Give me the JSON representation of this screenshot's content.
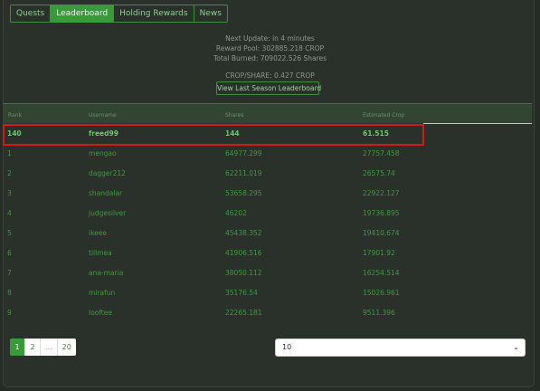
{
  "tabs": [
    {
      "label": "Quests",
      "active": false
    },
    {
      "label": "Leaderboard",
      "active": true
    },
    {
      "label": "Holding Rewards",
      "active": false
    },
    {
      "label": "News",
      "active": false
    }
  ],
  "info": {
    "next_update": "Next Update: in 4 minutes",
    "reward_pool": "Reward Pool: 302885.218 CROP",
    "total_burned": "Total Burned: 709022.526 Shares",
    "crop_per_share": "CROP/SHARE: 0.427 CROP",
    "season_button": "View Last Season Leaderboard"
  },
  "table": {
    "headers": [
      "Rank",
      "Username",
      "Shares",
      "Estimated Crop"
    ],
    "current_user": {
      "rank": "140",
      "username": "freed99",
      "shares": "144",
      "crop": "61.515"
    },
    "rows": [
      {
        "rank": "1",
        "username": "mengao",
        "shares": "64977.299",
        "crop": "27757.458"
      },
      {
        "rank": "2",
        "username": "dagger212",
        "shares": "62211.019",
        "crop": "26575.74"
      },
      {
        "rank": "3",
        "username": "shandalar",
        "shares": "53658.295",
        "crop": "22922.127"
      },
      {
        "rank": "4",
        "username": "judgesilver",
        "shares": "46202",
        "crop": "19736.895"
      },
      {
        "rank": "5",
        "username": "ikeee",
        "shares": "45438.352",
        "crop": "19410.674"
      },
      {
        "rank": "6",
        "username": "tillmea",
        "shares": "41906.516",
        "crop": "17901.92"
      },
      {
        "rank": "7",
        "username": "ana-maria",
        "shares": "38050.112",
        "crop": "16254.514"
      },
      {
        "rank": "8",
        "username": "mirafun",
        "shares": "35176.54",
        "crop": "15026.961"
      },
      {
        "rank": "9",
        "username": "looftee",
        "shares": "22265.181",
        "crop": "9511.396"
      }
    ]
  },
  "pagination": [
    "1",
    "2",
    "...",
    "20"
  ],
  "page_size": {
    "selected": "10"
  },
  "colors": {
    "accent": "#3a9a3a",
    "highlight_border": "#d11a1a",
    "background": "#252b25"
  }
}
